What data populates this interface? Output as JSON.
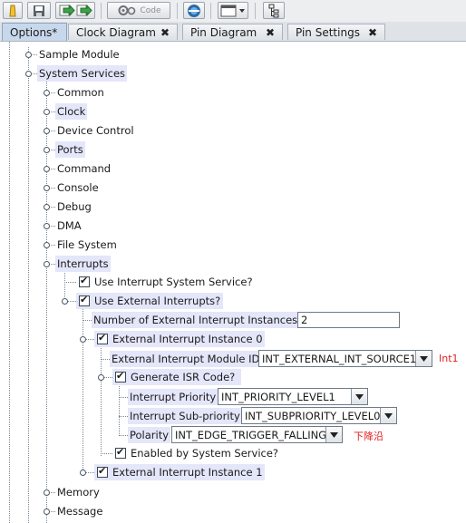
{
  "toolbar": {
    "code_label": "Code"
  },
  "tabs": [
    {
      "label": "Options*"
    },
    {
      "label": "Clock Diagram",
      "close": "✖"
    },
    {
      "label": "Pin Diagram",
      "close": "✖"
    },
    {
      "label": "Pin Settings",
      "close": "✖"
    }
  ],
  "tree": {
    "sample_module": "Sample Module",
    "system_services": "System Services",
    "common": "Common",
    "clock": "Clock",
    "device_control": "Device Control",
    "ports": "Ports",
    "command": "Command",
    "console": "Console",
    "debug": "Debug",
    "dma": "DMA",
    "file_system": "File System",
    "interrupts": "Interrupts",
    "use_interrupt_service": "Use Interrupt System Service?",
    "use_external_interrupts": "Use External Interrupts?",
    "num_ext_instances_label": "Number of External Interrupt Instances",
    "num_ext_instances_value": "2",
    "ext_instance_0": "External Interrupt Instance 0",
    "module_id_label": "External Interrupt Module ID",
    "module_id_value": "INT_EXTERNAL_INT_SOURCE1",
    "generate_isr": "Generate ISR Code?",
    "priority_label": "Interrupt Priority",
    "priority_value": "INT_PRIORITY_LEVEL1",
    "subpriority_label": "Interrupt Sub-priority",
    "subpriority_value": "INT_SUBPRIORITY_LEVEL0",
    "polarity_label": "Polarity",
    "polarity_value": "INT_EDGE_TRIGGER_FALLING",
    "enabled_by_service": "Enabled by System Service?",
    "ext_instance_1": "External Interrupt Instance 1",
    "memory": "Memory",
    "message": "Message"
  },
  "annotations": {
    "int1": "Int1",
    "falling_edge": "下降沿"
  },
  "colors": {
    "highlight": "#e4e6fa",
    "active_tab": "#c8d8ec",
    "annotation": "#e02020"
  }
}
